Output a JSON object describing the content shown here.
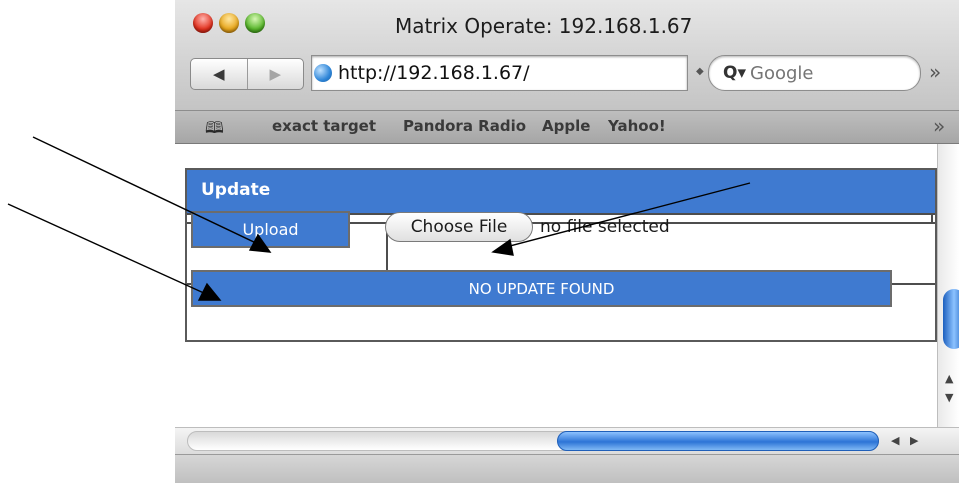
{
  "window": {
    "title": "Matrix Operate: 192.168.1.67",
    "url": "http://192.168.1.67/",
    "search_placeholder": "Google"
  },
  "toolbar": {
    "back_icon": "back-arrow-icon",
    "forward_icon": "forward-arrow-icon",
    "overflow_glyph": "»"
  },
  "bookmarks": [
    {
      "label": "exact target"
    },
    {
      "label": "Pandora Radio"
    },
    {
      "label": "Apple"
    },
    {
      "label": "Yahoo!"
    }
  ],
  "panel": {
    "title": "Update",
    "upload_label": "Upload",
    "choose_file_label": "Choose File",
    "no_file_text": "no file selected",
    "status_text": "NO UPDATE FOUND"
  },
  "colors": {
    "accent_blue": "#3f7ad0",
    "scroll_blue": "#2d74d6"
  }
}
